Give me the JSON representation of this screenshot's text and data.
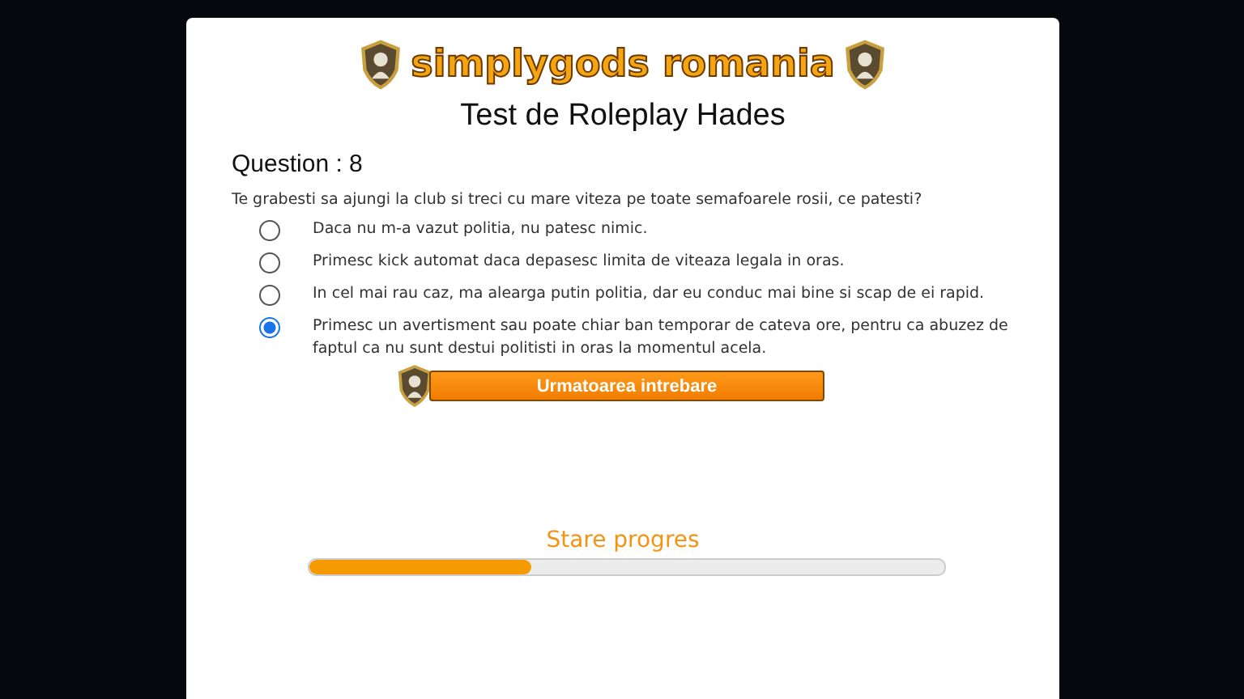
{
  "logo": {
    "text": "simplygods romania"
  },
  "title": "Test de Roleplay Hades",
  "question": {
    "heading": "Question : 8",
    "text": "Te grabesti sa ajungi la club si treci cu mare viteza pe toate semafoarele rosii, ce patesti?",
    "options": [
      {
        "label": "Daca nu m-a vazut politia, nu patesc nimic.",
        "selected": false
      },
      {
        "label": "Primesc kick automat daca depasesc limita de viteaza legala in oras.",
        "selected": false
      },
      {
        "label": "In cel mai rau caz, ma alearga putin politia, dar eu conduc mai bine si scap de ei rapid.",
        "selected": false
      },
      {
        "label": "Primesc un avertisment sau poate chiar ban temporar de cateva ore, pentru ca abuzez de faptul ca nu sunt destui politisti in oras la momentul acela.",
        "selected": true
      }
    ]
  },
  "next_button": "Urmatoarea intrebare",
  "progress": {
    "label": "Stare progres",
    "level": 0.35
  }
}
